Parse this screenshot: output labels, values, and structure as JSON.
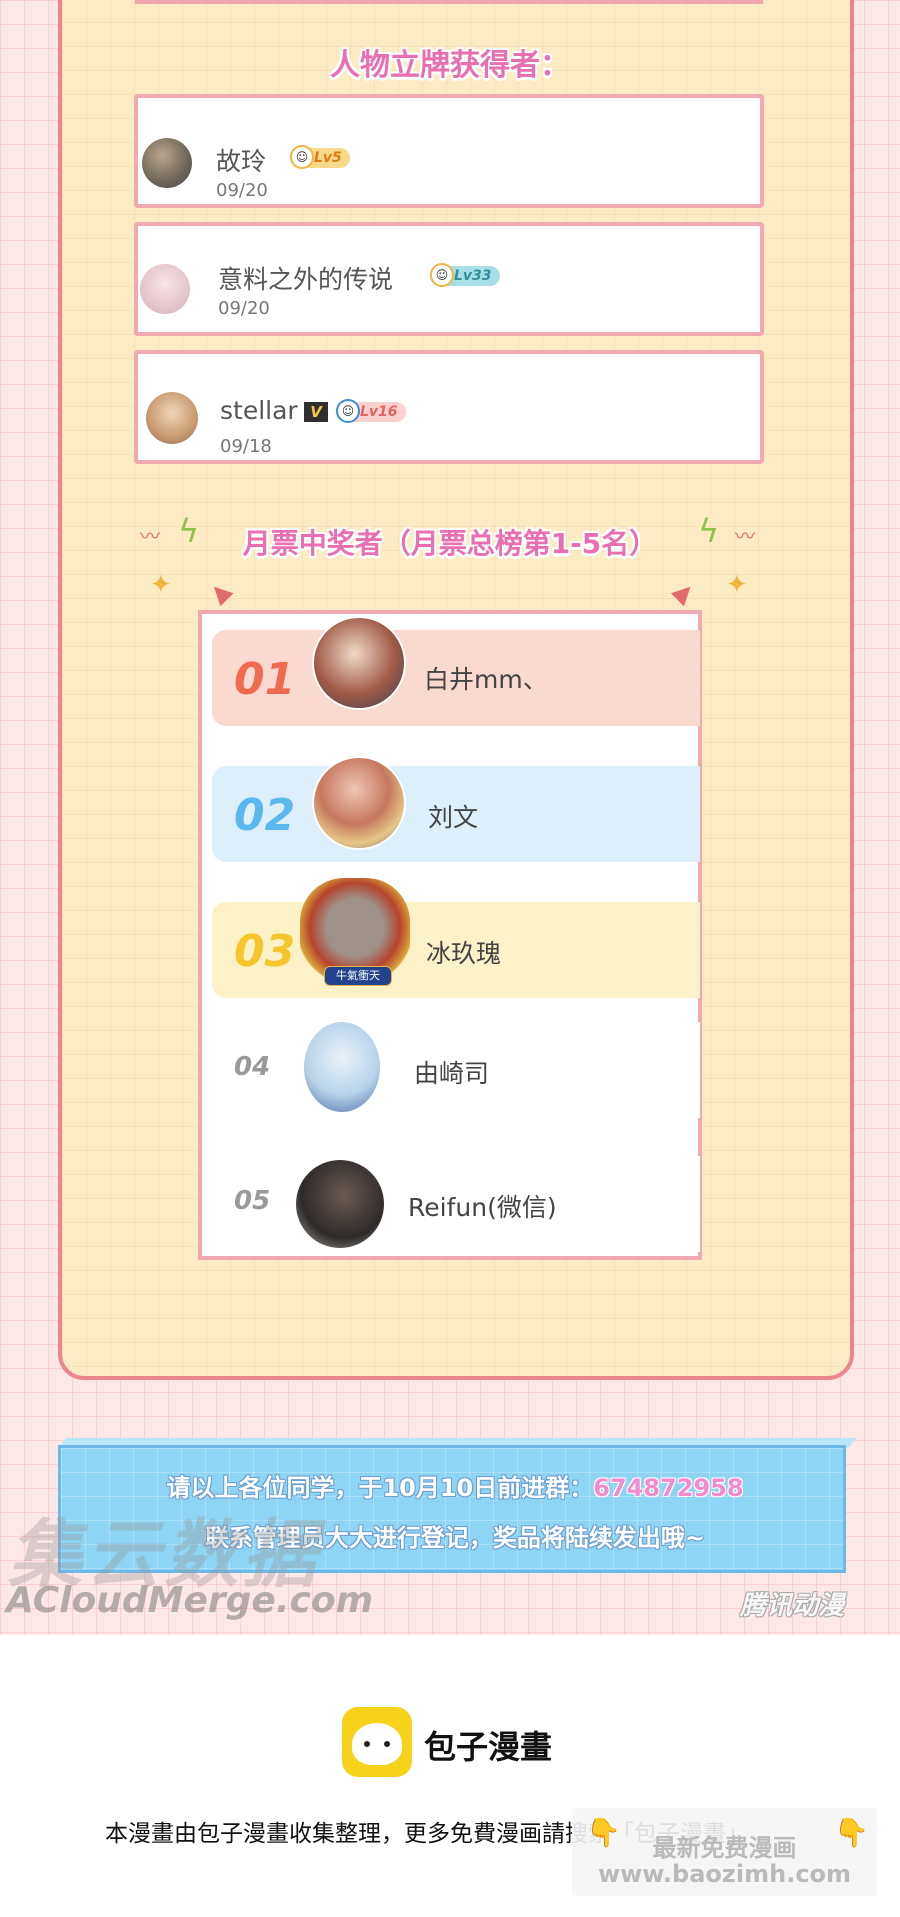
{
  "figure_winners": {
    "heading": "人物立牌获得者：",
    "entries": [
      {
        "name": "故玲",
        "date": "09/20",
        "level": "Lv5",
        "level_color": "#f7d98a"
      },
      {
        "name": "意料之外的传说",
        "date": "09/20",
        "level": "Lv33",
        "level_color": "#a7dfe6"
      },
      {
        "name": "stellar",
        "date": "09/18",
        "level": "Lv16",
        "level_color": "#fbd1cf",
        "vip_badge": "V"
      }
    ]
  },
  "monthly_ticket": {
    "heading": "月票中奖者（月票总榜第1-5名）",
    "ranks": [
      {
        "rank": "01",
        "name": "白井mm、",
        "row_color": "#f9d9d0",
        "num_color": "#f06a50"
      },
      {
        "rank": "02",
        "name": "刘文",
        "row_color": "#dceffb",
        "num_color": "#5bb8ec"
      },
      {
        "rank": "03",
        "name": "冰玖瑰",
        "row_color": "#fdf1c8",
        "num_color": "#f5c52b"
      },
      {
        "rank": "04",
        "name": "由崎司",
        "row_color": "#ffffff",
        "num_color": "#999999"
      },
      {
        "rank": "05",
        "name": "Reifun(微信)",
        "row_color": "#ffffff",
        "num_color": "#999999"
      }
    ],
    "frame_text": "牛氣衝天"
  },
  "notice": {
    "line1_prefix": "请以上各位同学，于10月10日前进群：",
    "qq_group": "674872958",
    "line2": "联系管理员大大进行登记，奖品将陆续发出哦~"
  },
  "watermarks": {
    "cn": "集云数据",
    "en": "ACloudMerge.com",
    "tencent": "腾讯动漫"
  },
  "footer": {
    "app_name": "包子漫畫",
    "description": "本漫畫由包子漫畫收集整理，更多免費漫画請搜索「包子漫畫」",
    "promo_line1": "最新免费漫画",
    "promo_line2": "www.baozimh.com"
  }
}
